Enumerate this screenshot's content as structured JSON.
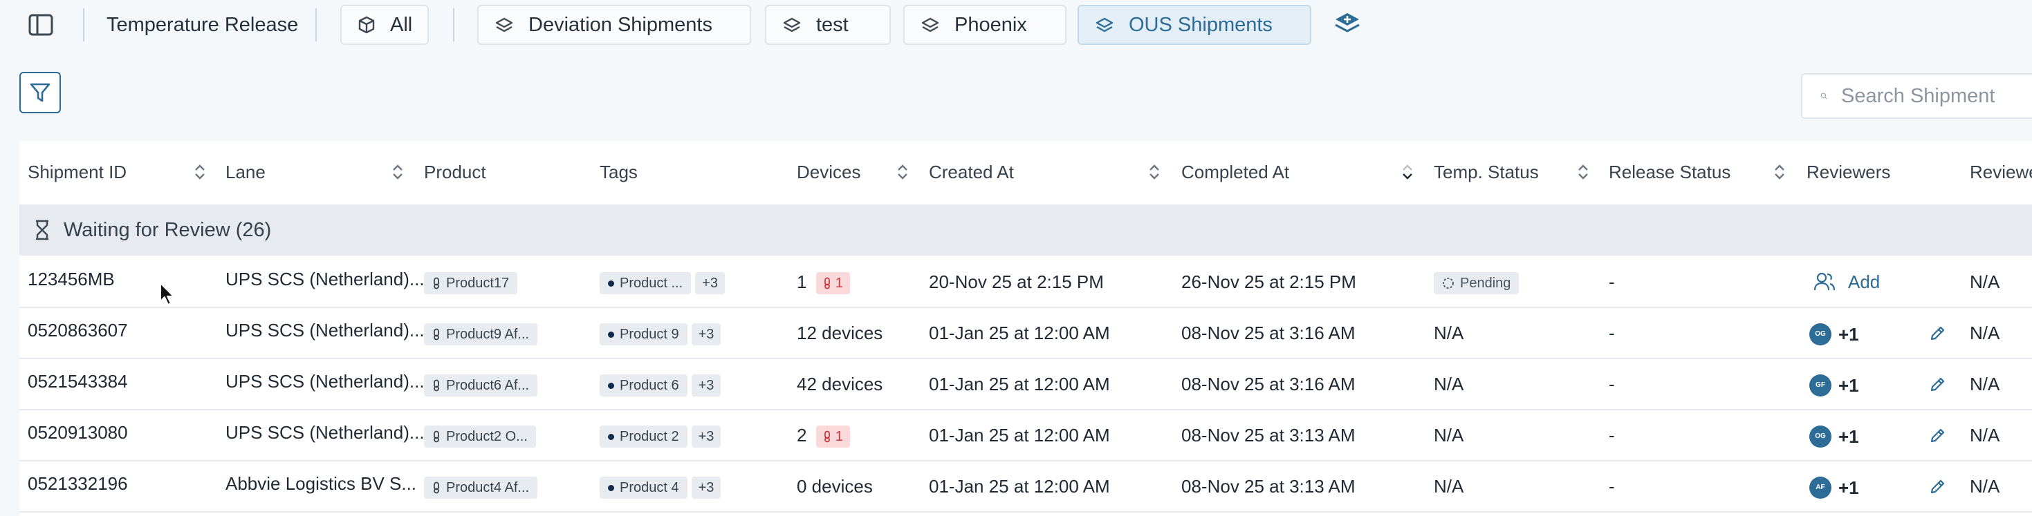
{
  "header": {
    "title": "Temperature Release",
    "views": [
      {
        "label": "All",
        "icon": "cube-icon"
      },
      {
        "label": "Deviation Shipments",
        "icon": "layers-icon"
      },
      {
        "label": "test",
        "icon": "layers-icon"
      },
      {
        "label": "Phoenix",
        "icon": "layers-icon"
      },
      {
        "label": "OUS Shipments",
        "icon": "layers-icon",
        "active": true
      }
    ],
    "add_view_icon": "add-layer-icon"
  },
  "toolbar": {
    "filter_icon": "filter-icon",
    "search_placeholder": "Search Shipment"
  },
  "table": {
    "columns": [
      {
        "label": "Shipment ID",
        "sortable": true
      },
      {
        "label": "Lane",
        "sortable": true
      },
      {
        "label": "Product",
        "sortable": false
      },
      {
        "label": "Tags",
        "sortable": false
      },
      {
        "label": "Devices",
        "sortable": true
      },
      {
        "label": "Created At",
        "sortable": true
      },
      {
        "label": "Completed At",
        "sortable": true,
        "sorted": "desc"
      },
      {
        "label": "Temp. Status",
        "sortable": true
      },
      {
        "label": "Release Status",
        "sortable": true
      },
      {
        "label": "Reviewers",
        "sortable": false
      },
      {
        "label": "Reviewe",
        "sortable": false
      }
    ],
    "group": {
      "label": "Waiting for Review (26)",
      "icon": "hourglass-icon"
    },
    "rows": [
      {
        "id": "123456MB",
        "lane": "UPS SCS (Netherland)...",
        "product": "Product17",
        "tag": "Product ...",
        "tag_more": "+3",
        "devices": "1",
        "alert_count": "1",
        "created": "20-Nov 25 at 2:15 PM",
        "completed": "26-Nov 25 at 2:15 PM",
        "temp_status": "Pending",
        "release_status": "-",
        "reviewer_add": "Add",
        "last": "N/A"
      },
      {
        "id": "0520863607",
        "lane": "UPS SCS (Netherland)...",
        "product": "Product9 Af...",
        "tag": "Product 9",
        "tag_more": "+3",
        "devices": "12 devices",
        "created": "01-Jan 25 at 12:00 AM",
        "completed": "08-Nov 25 at 3:16 AM",
        "temp_status": "N/A",
        "release_status": "-",
        "avatar": "OG",
        "reviewer_more": "+1",
        "last": "N/A"
      },
      {
        "id": "0521543384",
        "lane": "UPS SCS (Netherland)...",
        "product": "Product6 Af...",
        "tag": "Product 6",
        "tag_more": "+3",
        "devices": "42 devices",
        "created": "01-Jan 25 at 12:00 AM",
        "completed": "08-Nov 25 at 3:16 AM",
        "temp_status": "N/A",
        "release_status": "-",
        "avatar": "GF",
        "reviewer_more": "+1",
        "last": "N/A"
      },
      {
        "id": "0520913080",
        "lane": "UPS SCS (Netherland)...",
        "product": "Product2 O...",
        "tag": "Product 2",
        "tag_more": "+3",
        "devices": "2",
        "alert_count": "1",
        "created": "01-Jan 25 at 12:00 AM",
        "completed": "08-Nov 25 at 3:13 AM",
        "temp_status": "N/A",
        "release_status": "-",
        "avatar": "OG",
        "reviewer_more": "+1",
        "last": "N/A"
      },
      {
        "id": "0521332196",
        "lane": "Abbvie Logistics BV S...",
        "product": "Product4 Af...",
        "tag": "Product 4",
        "tag_more": "+3",
        "devices": "0 devices",
        "created": "01-Jan 25 at 12:00 AM",
        "completed": "08-Nov 25 at 3:13 AM",
        "temp_status": "N/A",
        "release_status": "-",
        "avatar": "AF",
        "reviewer_more": "+1",
        "last": "N/A"
      }
    ]
  },
  "colors": {
    "accent": "#2c6c97",
    "alert": "#c53b3f",
    "group_bg": "#e7ebf1"
  }
}
